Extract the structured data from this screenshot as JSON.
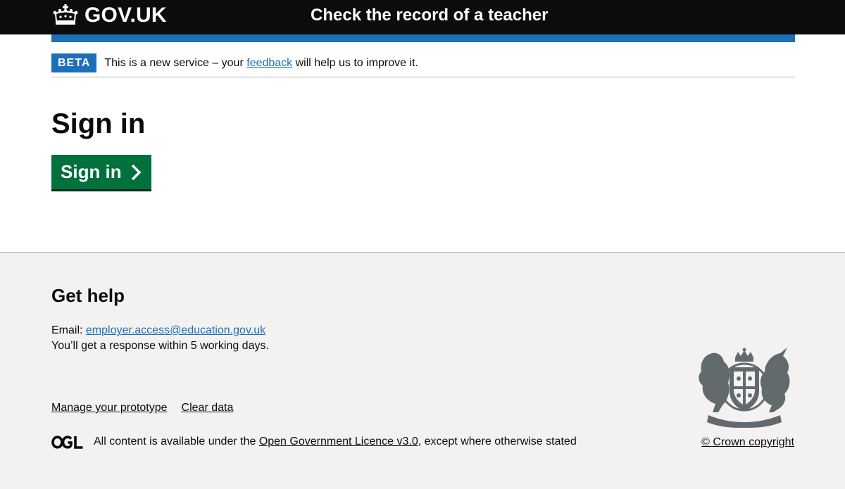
{
  "header": {
    "logo_text": "GOV.UK",
    "service_name": "Check the record of a teacher"
  },
  "phase_banner": {
    "tag": "BETA",
    "text_before": "This is a new service – your ",
    "link": "feedback",
    "text_after": " will help us to improve it."
  },
  "main": {
    "title": "Sign in",
    "button_label": "Sign in"
  },
  "footer": {
    "heading": "Get help",
    "email_label": "Email: ",
    "email": "employer.access@education.gov.uk",
    "response_text": "You’ll get a response within 5 working days.",
    "links": [
      "Manage your prototype",
      "Clear data"
    ],
    "licence_before": "All content is available under the ",
    "licence_link": "Open Government Licence v3.0",
    "licence_after": ", except where otherwise stated",
    "copyright": "© Crown copyright"
  },
  "colors": {
    "header_bg": "#0b0c0c",
    "brand_blue": "#1d70b8",
    "button_green": "#00703c",
    "footer_bg": "#f3f2f1"
  }
}
